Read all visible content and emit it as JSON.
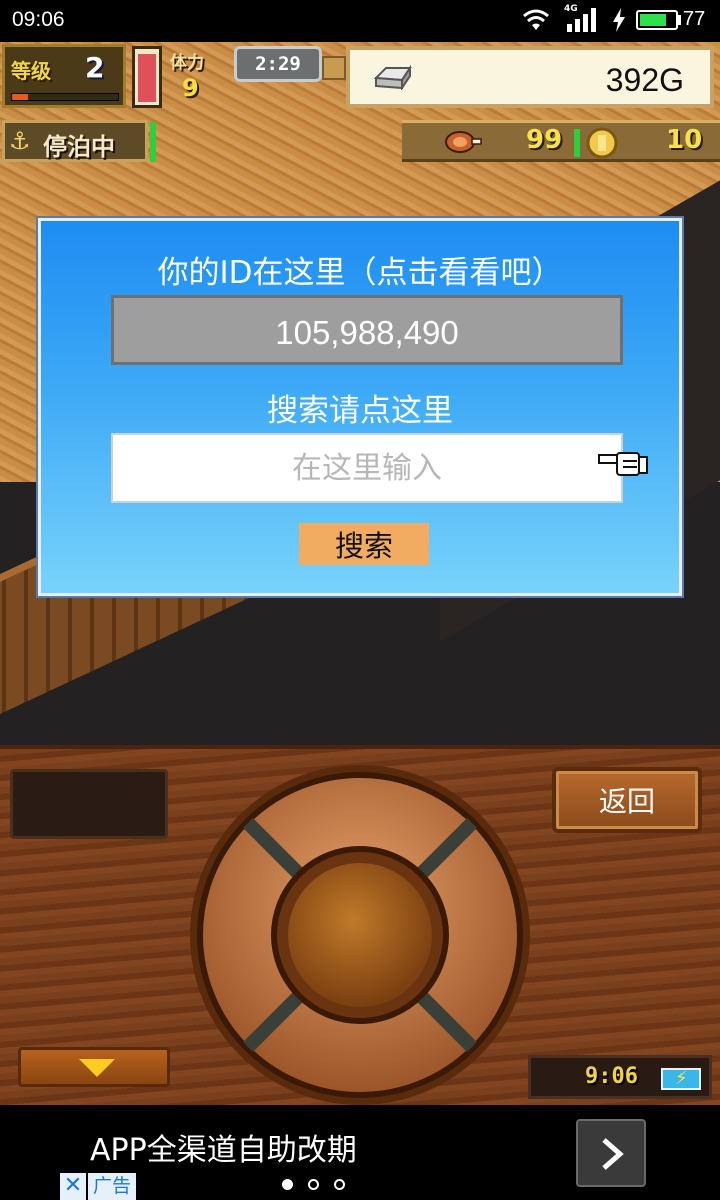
{
  "status_bar": {
    "time": "09:06",
    "network": "4G",
    "battery_percent": "77",
    "battery_level": 0.77,
    "battery_color": "#2ee04a",
    "icons": [
      "wifi-icon",
      "signal-icon",
      "charging-icon",
      "battery-icon"
    ]
  },
  "hud": {
    "level_label": "等级",
    "level": "2",
    "level_xp_fraction": 0.15,
    "stamina_fraction": 0.93,
    "crew_label": "体力",
    "crew_count": "9",
    "clock": "2:29",
    "gold": "392G",
    "dock_status": "停泊中",
    "food": "99",
    "medals": "10",
    "icons": [
      "gold-bar-icon",
      "anchor-icon",
      "meat-icon",
      "coin-icon"
    ]
  },
  "dialog": {
    "title": "你的ID在这里（点击看看吧）",
    "id_value": "105,988,490",
    "search_label": "搜索请点这里",
    "search_placeholder": "在这里输入",
    "search_value": "",
    "search_button": "搜索",
    "pointer_icon": "pointing-hand-icon",
    "colors": {
      "top": "#1d8df2",
      "bottom": "#78d3fb",
      "button": "#f2ac62"
    }
  },
  "controller": {
    "back_button": "返回",
    "clock": "9:06",
    "icons": [
      "dpad",
      "down-arrow-icon",
      "battery-icon"
    ]
  },
  "ad": {
    "text": "APP全渠道自助改期",
    "badge": "广告",
    "close_symbol": "✕",
    "page_dots": 3,
    "active_dot": 0
  }
}
